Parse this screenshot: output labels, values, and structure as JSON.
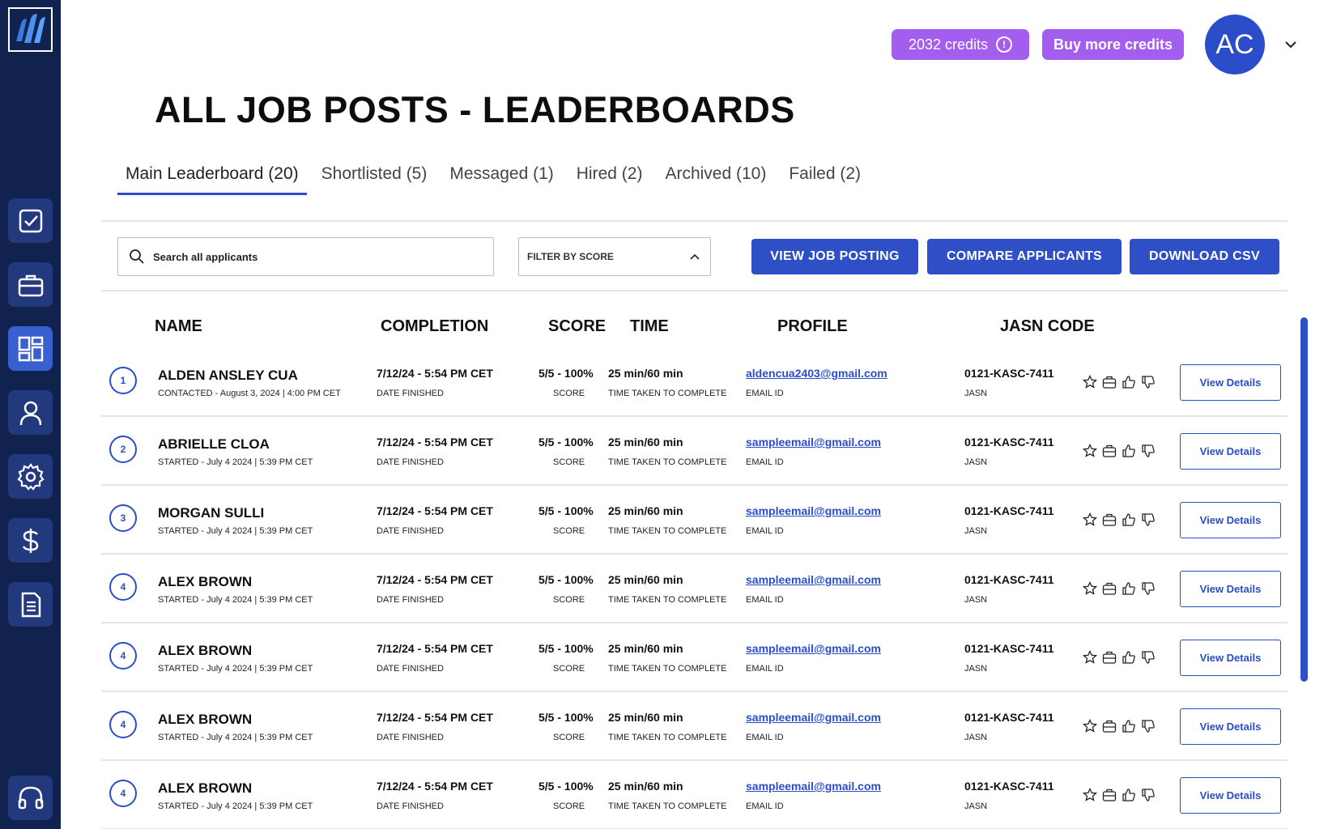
{
  "top": {
    "credits_label": "2032 credits",
    "buy_label": "Buy more credits",
    "avatar_initials": "AC"
  },
  "page": {
    "title": "ALL JOB POSTS - LEADERBOARDS"
  },
  "tabs": [
    "Main Leaderboard (20)",
    "Shortlisted (5)",
    "Messaged (1)",
    "Hired (2)",
    "Archived (10)",
    "Failed (2)"
  ],
  "toolbar": {
    "search_placeholder": "Search all applicants",
    "filter_label": "FILTER BY SCORE",
    "view_job_label": "VIEW JOB POSTING",
    "compare_label": "COMPARE APPLICANTS",
    "download_label": "DOWNLOAD CSV"
  },
  "columns": {
    "name": "NAME",
    "completion": "COMPLETION",
    "score": "SCORE",
    "time": "TIME",
    "profile": "PROFILE",
    "code": "JASN CODE"
  },
  "row_labels": {
    "completion_sub": "DATE FINISHED",
    "score_sub": "SCORE",
    "time_sub": "TIME TAKEN TO COMPLETE",
    "profile_sub": "EMAIL ID",
    "code_sub": "JASN",
    "details_button": "View Details"
  },
  "rows": [
    {
      "rank": "1",
      "name": "ALDEN ANSLEY CUA",
      "status": "CONTACTED - August 3, 2024 | 4:00 PM CET",
      "completion": "7/12/24 - 5:54 PM CET",
      "score": "5/5 - 100%",
      "time": "25 min/60 min",
      "email": "aldencua2403@gmail.com",
      "code": "0121-KASC-7411"
    },
    {
      "rank": "2",
      "name": "ABRIELLE CLOA",
      "status": "STARTED - July 4 2024 | 5:39 PM CET",
      "completion": "7/12/24 - 5:54 PM CET",
      "score": "5/5 - 100%",
      "time": "25 min/60 min",
      "email": "sampleemail@gmail.com",
      "code": "0121-KASC-7411"
    },
    {
      "rank": "3",
      "name": "MORGAN SULLI",
      "status": "STARTED - July 4 2024 | 5:39 PM CET",
      "completion": "7/12/24 - 5:54 PM CET",
      "score": "5/5 - 100%",
      "time": "25 min/60 min",
      "email": "sampleemail@gmail.com",
      "code": "0121-KASC-7411"
    },
    {
      "rank": "4",
      "name": "ALEX BROWN",
      "status": "STARTED - July 4 2024 | 5:39 PM CET",
      "completion": "7/12/24 - 5:54 PM CET",
      "score": "5/5 - 100%",
      "time": "25 min/60 min",
      "email": "sampleemail@gmail.com",
      "code": "0121-KASC-7411"
    },
    {
      "rank": "4",
      "name": "ALEX BROWN",
      "status": "STARTED - July 4 2024 | 5:39 PM CET",
      "completion": "7/12/24 - 5:54 PM CET",
      "score": "5/5 - 100%",
      "time": "25 min/60 min",
      "email": "sampleemail@gmail.com",
      "code": "0121-KASC-7411"
    },
    {
      "rank": "4",
      "name": "ALEX BROWN",
      "status": "STARTED - July 4 2024 | 5:39 PM CET",
      "completion": "7/12/24 - 5:54 PM CET",
      "score": "5/5 - 100%",
      "time": "25 min/60 min",
      "email": "sampleemail@gmail.com",
      "code": "0121-KASC-7411"
    },
    {
      "rank": "4",
      "name": "ALEX BROWN",
      "status": "STARTED - July 4 2024 | 5:39 PM CET",
      "completion": "7/12/24 - 5:54 PM CET",
      "score": "5/5 - 100%",
      "time": "25 min/60 min",
      "email": "sampleemail@gmail.com",
      "code": "0121-KASC-7411"
    }
  ],
  "icons": {
    "sidebar": [
      "check-square-icon",
      "briefcase-icon",
      "dashboard-icon",
      "user-icon",
      "settings-icon",
      "dollar-icon",
      "document-icon",
      "headset-icon"
    ],
    "row_actions": [
      "star-icon",
      "briefcase-icon",
      "thumbs-up-icon",
      "thumbs-down-icon"
    ]
  },
  "colors": {
    "sidebar": "#12224f",
    "primary": "#2f4fc7",
    "credits": "#a35ef0"
  }
}
